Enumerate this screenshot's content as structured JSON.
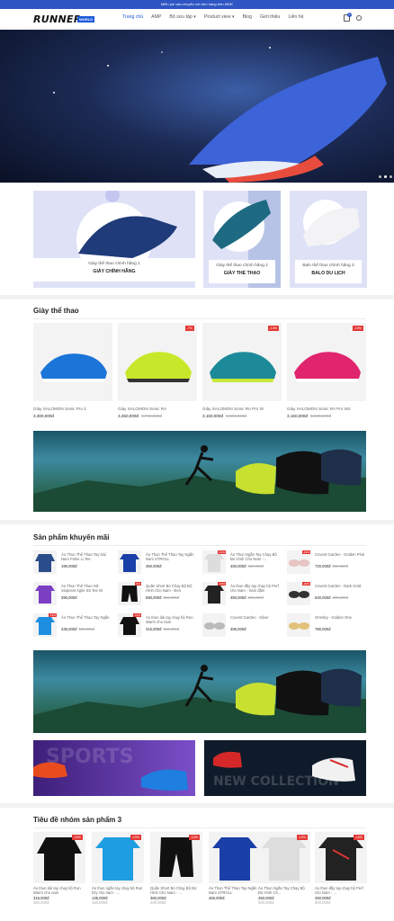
{
  "topbar": {
    "text": "Miễn phí vận chuyển với đơn hàng trên 500K"
  },
  "header": {
    "logo": "RUNNER",
    "logo_badge": "WORLD",
    "nav": [
      "Trang chủ",
      "AMP",
      "Bộ sưu tập ▾",
      "Product view ▾",
      "Blog",
      "Giới thiệu",
      "Liên hệ"
    ],
    "cart_count": "0"
  },
  "banners": [
    {
      "sub": "Giày thể thao chính hãng 1",
      "title": "GIÀY CHÍNH HÃNG"
    },
    {
      "sub": "Giày thể thao chính hãng 2",
      "title": "GIÀY THỂ THAO"
    },
    {
      "sub": "Balo thể thao chính hãng 3",
      "title": "BALO DU LỊCH"
    }
  ],
  "section1": {
    "title": "Giày thể thao",
    "products": [
      {
        "name": "Giày SALOMON Sonic Pro 2",
        "price": "3,300,000đ",
        "old": "",
        "badge": ""
      },
      {
        "name": "Giày SALOMON Sonic RA",
        "price": "3,450,000đ",
        "old": "3,750,000đ",
        "badge": "-7%"
      },
      {
        "name": "Giày SALOMON Sonic RA Pro W",
        "price": "3,150,000đ",
        "old": "3,600,000đ",
        "badge": "-14%"
      },
      {
        "name": "Giày SALOMON Sonic RA Pro W2",
        "price": "3,150,000đ",
        "old": "3,500,000đ",
        "badge": "-10%"
      }
    ]
  },
  "section2": {
    "title": "Sản phẩm khuyến mãi",
    "items": [
      {
        "name": "Áo Thun Thể Thao Tay Dài Nam Pulse Li Tee",
        "price": "190,000đ",
        "old": "",
        "badge": ""
      },
      {
        "name": "Áo Thun Thể Thao Tay Ngắn Nam STROLL",
        "price": "450,000đ",
        "old": "",
        "badge": ""
      },
      {
        "name": "Áo Thun Ngắn Tay Chạy Bộ Đủ Hình Cho Nam -...",
        "price": "450,000đ",
        "old": "500,000đ",
        "badge": "-10%"
      },
      {
        "name": "Covent Garden - Golden Pink",
        "price": "720,000đ",
        "old": "800,000đ",
        "badge": "-10%"
      },
      {
        "name": "Áo Thun Thể Thao Nữ Sixpriest Agile SS Tee W",
        "price": "390,000đ",
        "old": "",
        "badge": ""
      },
      {
        "name": "Quần Short Bó Chạy Bộ Độ Hình Cho Nam - Đen",
        "price": "590,000đ",
        "old": "650,000đ",
        "badge": "-9%"
      },
      {
        "name": "Áo thun đầy tay chạy bộ Perf cho Nam - Xám đậm",
        "price": "450,000đ",
        "old": "500,000đ",
        "badge": "-10%"
      },
      {
        "name": "Covent Garden - Dark Gold",
        "price": "640,000đ",
        "old": "800,000đ",
        "badge": "-20%"
      },
      {
        "name": "Áo Thun Thể Thao Tay Ngắn",
        "price": "435,000đ",
        "old": "500,000đ",
        "badge": "-13%"
      },
      {
        "name": "Áo thun dài tay chạy bộ Run Warm cho nam",
        "price": "315,000đ",
        "old": "350,000đ",
        "badge": "-10%"
      },
      {
        "name": "Covent Garden - Silver",
        "price": "495,000đ",
        "old": "",
        "badge": ""
      },
      {
        "name": "Ormsby - Golden One",
        "price": "780,000đ",
        "old": "",
        "badge": ""
      }
    ]
  },
  "promo_banners": {
    "left": "SPORTS",
    "right": "NEW COLLECTION"
  },
  "section3": {
    "title": "Tiêu đề nhóm sản phẩm 3",
    "products": [
      {
        "name": "Áo thun dài tay chạy bộ Run Warm cho nam",
        "price": "315,000đ",
        "old": "350,000đ",
        "badge": "-10%"
      },
      {
        "name": "Áo thun ngắn tay chạy bộ Run Dry cho nam - ...",
        "price": "135,000đ",
        "old": "150,000đ",
        "badge": "-10%"
      },
      {
        "name": "Quần Short Bó Chạy Bộ Đủ Hình Cho Nam - ...",
        "price": "360,000đ",
        "old": "400,000đ",
        "badge": "-10%"
      },
      {
        "name": "Áo Thun Thể Thao Tay Ngắn Nam STROLL",
        "price": "450,000đ",
        "old": "",
        "badge": ""
      },
      {
        "name": "Áo Thun Ngắn Tay Chạy Bộ Đủ Hình Ch...",
        "price": "450,000đ",
        "old": "500,000đ",
        "badge": "-10%"
      },
      {
        "name": "Áo thun đầy tay chạy bộ Perf cho Nam - ...",
        "price": "450,000đ",
        "old": "500,000đ",
        "badge": "-10%"
      }
    ]
  }
}
